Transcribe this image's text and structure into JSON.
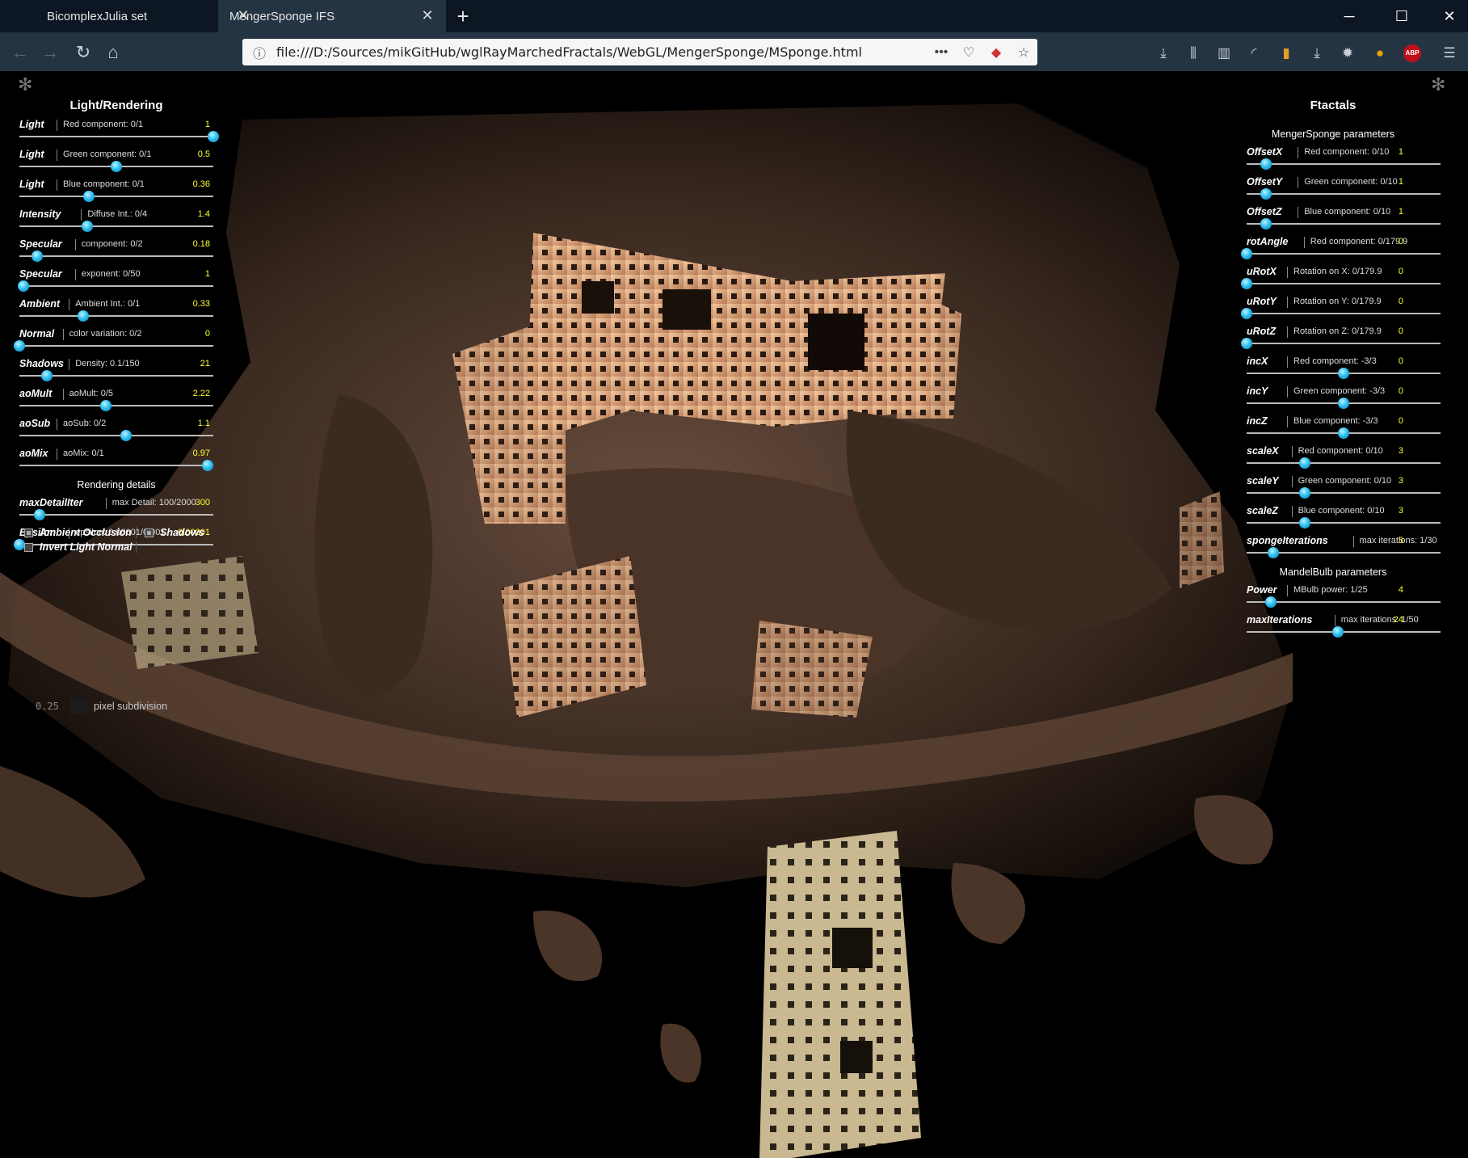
{
  "browser": {
    "tabs": [
      {
        "label": "BicomplexJulia set",
        "active": false
      },
      {
        "label": "MengerSponge IFS",
        "active": true
      }
    ],
    "url": "file:///D:/Sources/mikGitHub/wglRayMarchedFractals/WebGL/MengerSponge/MSponge.html"
  },
  "left_panel": {
    "title": "Light/Rendering",
    "controls": [
      {
        "label": "Light",
        "desc": "Red component: 0/1",
        "value": "1",
        "fraction": 1.0
      },
      {
        "label": "Light",
        "desc": "Green component: 0/1",
        "value": "0.5",
        "fraction": 0.5
      },
      {
        "label": "Light",
        "desc": "Blue component: 0/1",
        "value": "0.36",
        "fraction": 0.36
      },
      {
        "label": "Intensity",
        "desc": "Diffuse Int.: 0/4",
        "value": "1.4",
        "fraction": 0.35
      },
      {
        "label": "Specular",
        "desc": "component: 0/2",
        "value": "0.18",
        "fraction": 0.09
      },
      {
        "label": "Specular",
        "desc": "exponent: 0/50",
        "value": "1",
        "fraction": 0.02
      },
      {
        "label": "Ambient",
        "desc": "Ambient Int.: 0/1",
        "value": "0.33",
        "fraction": 0.33
      },
      {
        "label": "Normal",
        "desc": "color variation: 0/2",
        "value": "0",
        "fraction": 0.0
      },
      {
        "label": "Shadows",
        "desc": "Density: 0.1/150",
        "value": "21",
        "fraction": 0.14
      },
      {
        "label": "aoMult",
        "desc": "aoMult: 0/5",
        "value": "2.22",
        "fraction": 0.444
      },
      {
        "label": "aoSub",
        "desc": "aoSub: 0/2",
        "value": "1.1",
        "fraction": 0.55
      },
      {
        "label": "aoMix",
        "desc": "aoMix: 0/1",
        "value": "0.97",
        "fraction": 0.97
      }
    ],
    "details_title": "Rendering details",
    "details": [
      {
        "label": "maxDetailIter",
        "desc": "max Detail: 100/2000",
        "value": "300",
        "fraction": 0.105
      },
      {
        "label": "Epsilon",
        "desc": "epsilon: 0.00001/0.001",
        "value": "0.00001",
        "fraction": 0.0
      }
    ],
    "checkboxes": [
      {
        "label": "Ambient Occlusion",
        "checked": true
      },
      {
        "label": "Shadows",
        "checked": true
      },
      {
        "label": "Invert Light Normal",
        "checked": false
      }
    ],
    "pixel_subdivision": {
      "value": "0.25",
      "label": "pixel subdivision"
    }
  },
  "right_panel": {
    "title": "Ftactals",
    "sponge_title": "MengerSponge parameters",
    "sponge_controls": [
      {
        "label": "OffsetX",
        "desc": "Red component: 0/10",
        "value": "1",
        "fraction": 0.1
      },
      {
        "label": "OffsetY",
        "desc": "Green component: 0/10",
        "value": "1",
        "fraction": 0.1
      },
      {
        "label": "OffsetZ",
        "desc": "Blue component: 0/10",
        "value": "1",
        "fraction": 0.1
      },
      {
        "label": "rotAngle",
        "desc": "Red component: 0/179.9",
        "value": "0",
        "fraction": 0.0
      },
      {
        "label": "uRotX",
        "desc": "Rotation on X: 0/179.9",
        "value": "0",
        "fraction": 0.0
      },
      {
        "label": "uRotY",
        "desc": "Rotation on Y: 0/179.9",
        "value": "0",
        "fraction": 0.0
      },
      {
        "label": "uRotZ",
        "desc": "Rotation on Z: 0/179.9",
        "value": "0",
        "fraction": 0.0
      },
      {
        "label": "incX",
        "desc": "Red component: -3/3",
        "value": "0",
        "fraction": 0.5
      },
      {
        "label": "incY",
        "desc": "Green component: -3/3",
        "value": "0",
        "fraction": 0.5
      },
      {
        "label": "incZ",
        "desc": "Blue component: -3/3",
        "value": "0",
        "fraction": 0.5
      },
      {
        "label": "scaleX",
        "desc": "Red component: 0/10",
        "value": "3",
        "fraction": 0.3
      },
      {
        "label": "scaleY",
        "desc": "Green component: 0/10",
        "value": "3",
        "fraction": 0.3
      },
      {
        "label": "scaleZ",
        "desc": "Blue component: 0/10",
        "value": "3",
        "fraction": 0.3
      },
      {
        "label": "spongeIterations",
        "desc": "max iterations: 1/30",
        "value": "5",
        "fraction": 0.138
      }
    ],
    "mandel_title": "MandelBulb parameters",
    "mandel_controls": [
      {
        "label": "Power",
        "desc": "MBulb power: 1/25",
        "value": "4",
        "fraction": 0.125
      },
      {
        "label": "maxIterations",
        "desc": "max iterations: 1/50",
        "value": "24",
        "fraction": 0.469
      }
    ]
  },
  "colors": {
    "value_text": "#ffff30",
    "knob": "#2ec0f0",
    "tabbar": "#0c1723",
    "navbar": "#243443"
  }
}
